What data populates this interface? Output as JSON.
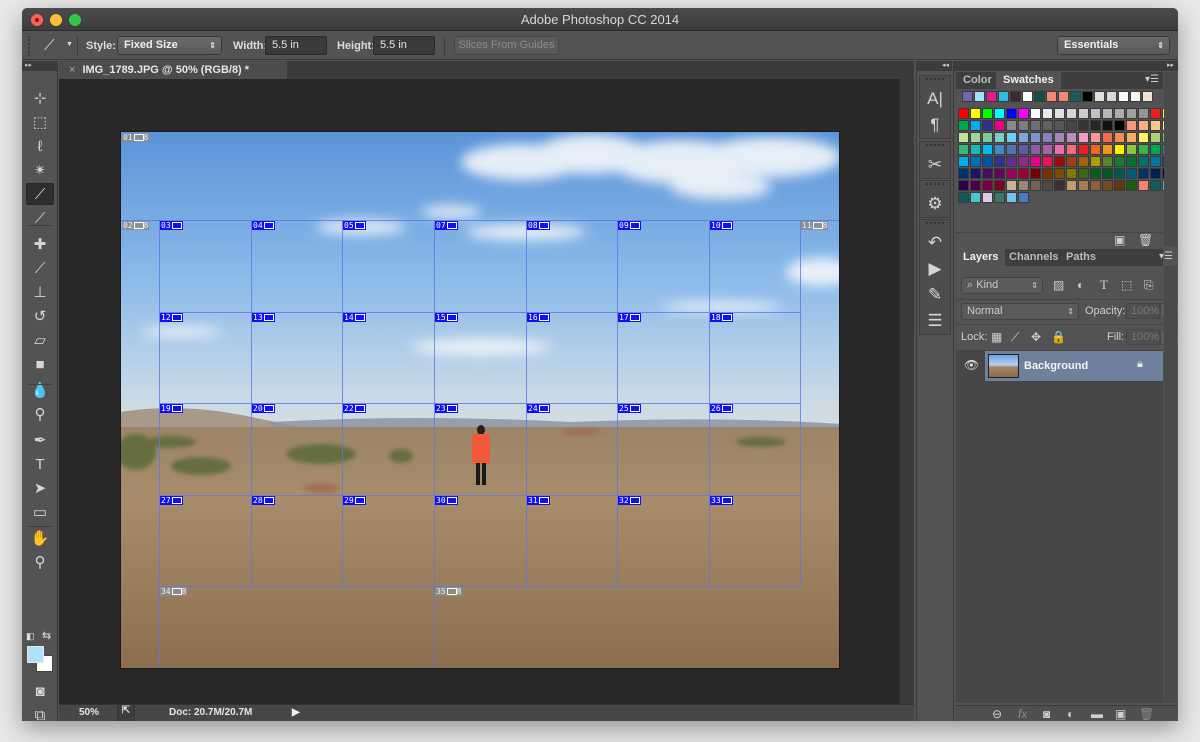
{
  "window": {
    "title": "Adobe Photoshop CC 2014"
  },
  "options_bar": {
    "tool_icon": "slice-tool-icon",
    "style_label": "Style:",
    "style_value": "Fixed Size",
    "width_label": "Width:",
    "width_value": "5.5 in",
    "height_label": "Height:",
    "height_value": "5.5 in",
    "slices_from_guides": "Slices From Guides",
    "workspace": "Essentials"
  },
  "document": {
    "tab_title": "IMG_1789.JPG @ 50% (RGB/8) *",
    "close": "×"
  },
  "status_bar": {
    "zoom": "50%",
    "doc_info": "Doc: 20.7M/20.7M"
  },
  "toolbox": {
    "tools": [
      {
        "name": "move-tool",
        "glyph": "⊹"
      },
      {
        "name": "rectangular-marquee-tool",
        "glyph": "⬚"
      },
      {
        "name": "lasso-tool",
        "glyph": "ℓ"
      },
      {
        "name": "magic-wand-tool",
        "glyph": "✴"
      },
      {
        "name": "slice-tool",
        "glyph": "⟋",
        "active": true
      },
      {
        "name": "eyedropper-tool",
        "glyph": "⟋"
      },
      {
        "name": "healing-brush-tool",
        "glyph": "✚"
      },
      {
        "name": "brush-tool",
        "glyph": "⟋"
      },
      {
        "name": "clone-stamp-tool",
        "glyph": "⊥"
      },
      {
        "name": "history-brush-tool",
        "glyph": "↺"
      },
      {
        "name": "eraser-tool",
        "glyph": "▱"
      },
      {
        "name": "gradient-tool",
        "glyph": "■"
      },
      {
        "name": "blur-tool",
        "glyph": "💧"
      },
      {
        "name": "dodge-tool",
        "glyph": "⚲"
      },
      {
        "name": "pen-tool",
        "glyph": "✒"
      },
      {
        "name": "type-tool",
        "glyph": "T"
      },
      {
        "name": "path-selection-tool",
        "glyph": "➤"
      },
      {
        "name": "rectangle-tool",
        "glyph": "▭"
      },
      {
        "name": "hand-tool",
        "glyph": "✋"
      },
      {
        "name": "zoom-tool",
        "glyph": "⚲"
      }
    ],
    "foreground_color": "#aee0f7",
    "background_color": "#ffffff"
  },
  "mid_panel": {
    "groups": [
      [
        "character-icon",
        "paragraph-icon"
      ],
      [
        "tool-presets-icon"
      ],
      [
        "3d-icon"
      ],
      [
        "history-icon",
        "actions-icon",
        "brushes-icon",
        "brush-presets-icon"
      ]
    ],
    "glyphs": {
      "character-icon": "A|",
      "paragraph-icon": "¶",
      "tool-presets-icon": "✂",
      "3d-icon": "⚙",
      "history-icon": "↶",
      "actions-icon": "▶",
      "brushes-icon": "✎",
      "brush-presets-icon": "☰"
    }
  },
  "swatches_panel": {
    "tabs": [
      {
        "label": "Color"
      },
      {
        "label": "Swatches",
        "active": true
      }
    ],
    "recent": [
      "#6f65b0",
      "#a3e2f7",
      "#e6198f",
      "#31bde6",
      "#3f2836",
      "#ffffff",
      "#114f4d",
      "#f08b6c",
      "#ef8a6e",
      "#155d5c",
      "#000000",
      "#e1e1d6",
      "#d9d7d4",
      "#f6fcfc",
      "#faf7ef",
      "#f0e1d5"
    ],
    "grid": [
      [
        "#ff0000",
        "#ffff00",
        "#00ff00",
        "#00ffff",
        "#0000ff",
        "#ff00ff",
        "#ffffff",
        "#ebebeb",
        "#e1e1e1",
        "#d7d7d7",
        "#cccccc",
        "#c2c2c2",
        "#b7b7b7",
        "#acacac",
        "#a0a0a0",
        "#959595",
        "#ee1c24",
        "#fff100"
      ],
      [
        "#00a650",
        "#00aeef",
        "#2e3192",
        "#ec008c",
        "#898989",
        "#7d7d7d",
        "#707070",
        "#626262",
        "#555555",
        "#464646",
        "#363636",
        "#262626",
        "#111111",
        "#000000",
        "#f7977a",
        "#fbad82",
        "#fdc68c",
        "#fff799"
      ],
      [
        "#c6df9c",
        "#a4d49d",
        "#81ca9d",
        "#7bcdc9",
        "#6ccff7",
        "#7ca6d8",
        "#8293ca",
        "#8881be",
        "#a286bd",
        "#bc8cbf",
        "#f49bc1",
        "#f5999d",
        "#f16c4d",
        "#f68e54",
        "#fbaf5a",
        "#fff467",
        "#acd372",
        "#7dc473"
      ],
      [
        "#39b778",
        "#17bcb4",
        "#00bef2",
        "#438ccb",
        "#5573b7",
        "#5e5ca7",
        "#855fa8",
        "#a763a9",
        "#ef6ea8",
        "#f16d7e",
        "#ee1d24",
        "#f16522",
        "#f7941d",
        "#fff100",
        "#8fc63d",
        "#37b44a",
        "#00a650",
        "#00a99e"
      ],
      [
        "#00aeef",
        "#0072bc",
        "#0054a5",
        "#2f3192",
        "#652c91",
        "#91278f",
        "#ed008c",
        "#ee105a",
        "#9d0a0f",
        "#a1410d",
        "#a36209",
        "#aba000",
        "#588528",
        "#197b30",
        "#007236",
        "#00736a",
        "#0076a4",
        "#004a80"
      ],
      [
        "#003370",
        "#1d1363",
        "#450e61",
        "#62055f",
        "#9e005c",
        "#9d0039",
        "#790000",
        "#7b3000",
        "#7c4900",
        "#827a00",
        "#3e6617",
        "#045f20",
        "#005824",
        "#005951",
        "#005b7e",
        "#003562",
        "#002056",
        "#0c004b"
      ],
      [
        "#30004a",
        "#4b0048",
        "#7a0045",
        "#7a0026",
        "#c7b299",
        "#998675",
        "#736357",
        "#534741",
        "#37302c",
        "#c69c6d",
        "#a67c52",
        "#8c6239",
        "#754c24",
        "#603913",
        "#1a5c12",
        "#f08670",
        "#105e5b",
        "#2dbde6"
      ],
      [
        "#125956",
        "#45c7d1",
        "#ddcce3",
        "#3d756d",
        "#70c4e7",
        "#4a7bc2"
      ]
    ]
  },
  "layers_panel": {
    "tabs": [
      {
        "label": "Layers",
        "active": true
      },
      {
        "label": "Channels"
      },
      {
        "label": "Paths"
      }
    ],
    "filter_kind": "Kind",
    "blend_mode": "Normal",
    "opacity_label": "Opacity:",
    "opacity_value": "100%",
    "lock_label": "Lock:",
    "fill_label": "Fill:",
    "fill_value": "100%",
    "layers": [
      {
        "name": "Background",
        "visible": true,
        "locked": true,
        "selected": true
      }
    ],
    "footer_icons": [
      "link-layers-icon",
      "fx-icon",
      "add-mask-icon",
      "adjustment-layer-icon",
      "new-group-icon",
      "new-layer-icon",
      "delete-layer-icon"
    ]
  },
  "slices": {
    "auto": [
      "01",
      "02",
      "11",
      "34",
      "35"
    ],
    "user_rows": [
      [
        "03",
        "04",
        "05",
        "07",
        "08",
        "09",
        "10"
      ],
      [
        "12",
        "13",
        "14",
        "15",
        "16",
        "17",
        "18"
      ],
      [
        "19",
        "20",
        "22",
        "23",
        "24",
        "25",
        "26"
      ],
      [
        "27",
        "28",
        "29",
        "30",
        "31",
        "32",
        "33"
      ]
    ]
  }
}
